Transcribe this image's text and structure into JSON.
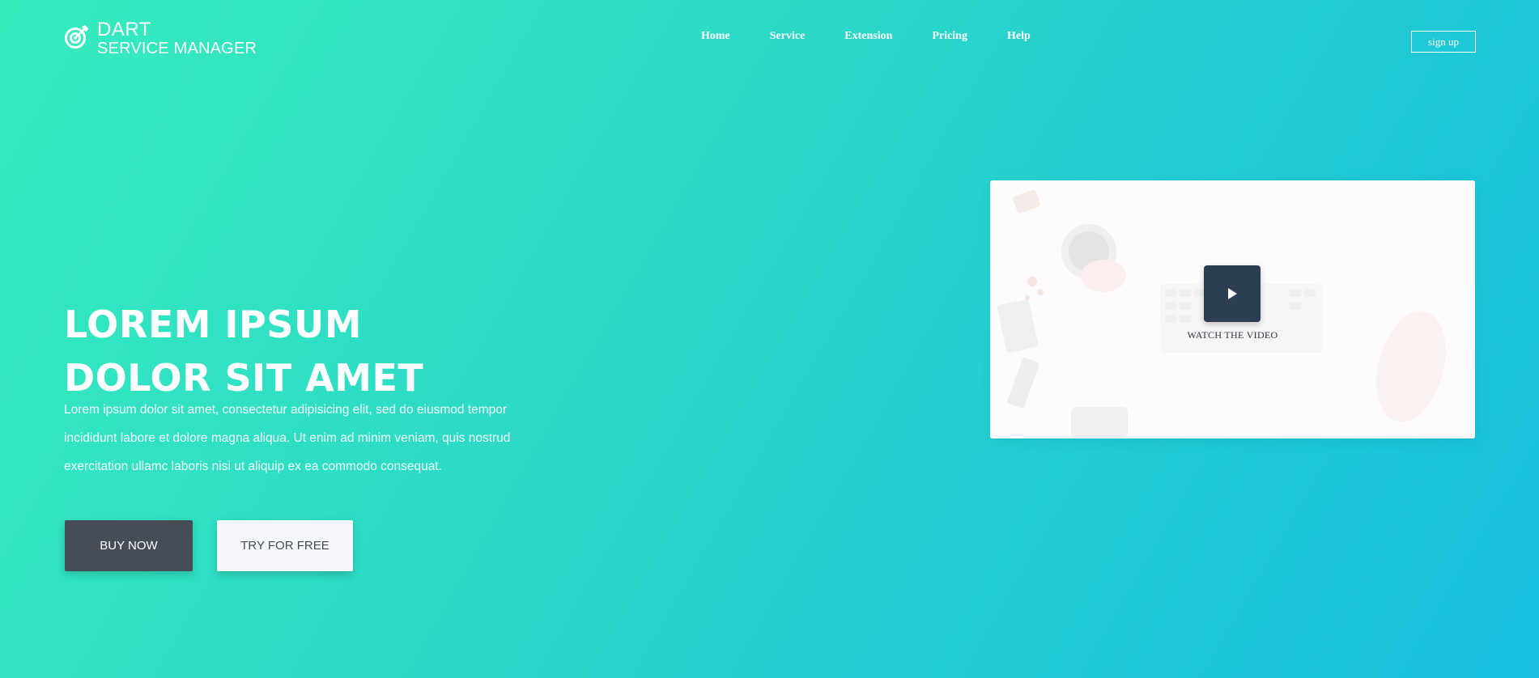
{
  "brand": {
    "line1": "DART",
    "line2": "SERVICE MANAGER",
    "icon": "target-icon"
  },
  "nav": {
    "items": [
      {
        "label": "Home"
      },
      {
        "label": "Service"
      },
      {
        "label": "Extension"
      },
      {
        "label": "Pricing"
      },
      {
        "label": "Help"
      }
    ],
    "signup_label": "sign up"
  },
  "hero": {
    "title_line1": "LOREM IPSUM",
    "title_line2": "DOLOR SIT AMET",
    "description": "Lorem ipsum dolor sit amet, consectetur adipisicing elit, sed do eiusmod tempor incididunt labore et dolore magna aliqua. Ut enim ad minim veniam, quis nostrud exercitation ullamc laboris nisi ut aliquip ex ea commodo consequat.",
    "buy_label": "BUY NOW",
    "try_label": "TRY FOR FREE"
  },
  "video": {
    "label": "WATCH THE VIDEO",
    "icon": "play-icon"
  },
  "colors": {
    "gradient_start": "#36ecbd",
    "gradient_end": "#18bfe0",
    "buy_button": "#474d57",
    "play_button": "#2e3e52"
  }
}
